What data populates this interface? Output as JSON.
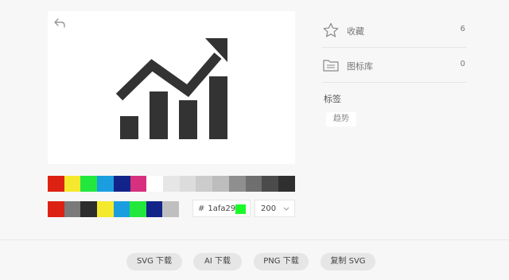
{
  "preview": {
    "back_icon": "undo-arrow-icon",
    "icon_name": "trend-chart-icon",
    "icon_color": "#333333"
  },
  "palette": {
    "row1": [
      "#dd2213",
      "#f5e92d",
      "#22e83d",
      "#1a9ee0",
      "#12248a",
      "#d6307f",
      "#ffffff",
      "#e6e6e6",
      "#dcdcdc",
      "#cccccc",
      "#bdbdbd",
      "#8f8f8f",
      "#6f6f6f",
      "#4b4b4b",
      "#2f2f2f"
    ],
    "row2": [
      "#dd2213",
      "#7a7a7a",
      "#2d2d2d",
      "#f5e92d",
      "#1a9ee0",
      "#22e83d",
      "#12248a",
      "#bfbfbf"
    ]
  },
  "color_input": {
    "hash": "#",
    "value": "1afa29",
    "swatch": "#1afa29"
  },
  "size_select": {
    "value": "200",
    "icon": "chevron-down-icon"
  },
  "meta": {
    "favorites": {
      "label": "收藏",
      "count": "6",
      "icon": "star-icon"
    },
    "library": {
      "label": "图标库",
      "count": "0",
      "icon": "folder-list-icon"
    }
  },
  "tags": {
    "title": "标签",
    "items": [
      "趋势"
    ]
  },
  "actions": {
    "svg_download": "SVG 下载",
    "ai_download": "AI 下载",
    "png_download": "PNG 下载",
    "copy_svg": "复制 SVG"
  }
}
